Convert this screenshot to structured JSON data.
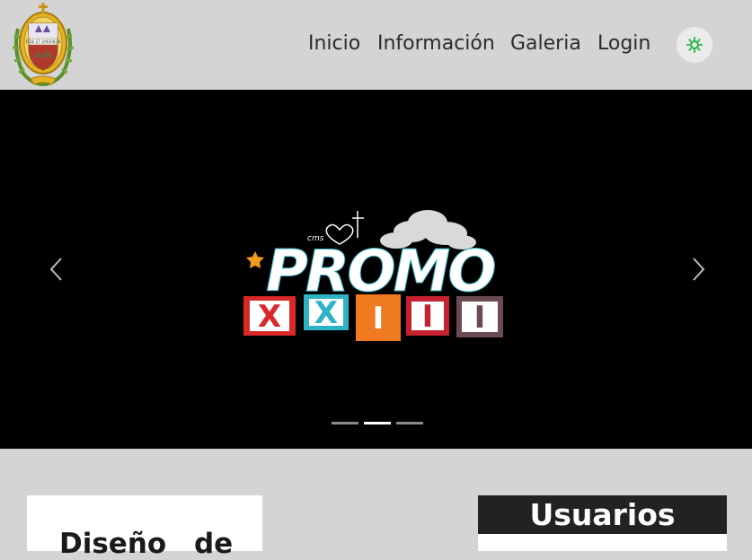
{
  "header": {
    "logo_motto": "FIDE ET OPERIBUS",
    "nav": [
      "Inicio",
      "Información",
      "Galeria",
      "Login"
    ],
    "theme_toggle_icon": "sun-icon"
  },
  "carousel": {
    "slide_logo_text": {
      "small": "cms",
      "main": "PROMO",
      "letters": [
        "X",
        "X",
        "I",
        "I",
        "I"
      ]
    },
    "active_slide": 2,
    "slide_count": 3,
    "prev_icon": "chevron-left-icon",
    "next_icon": "chevron-right-icon"
  },
  "content": {
    "card_title": "Diseño de",
    "users_title": "Usuarios"
  },
  "colors": {
    "background": "#d4d4d4",
    "carousel_bg": "#000000",
    "accent_green": "#2db84d",
    "users_header": "#222222"
  }
}
